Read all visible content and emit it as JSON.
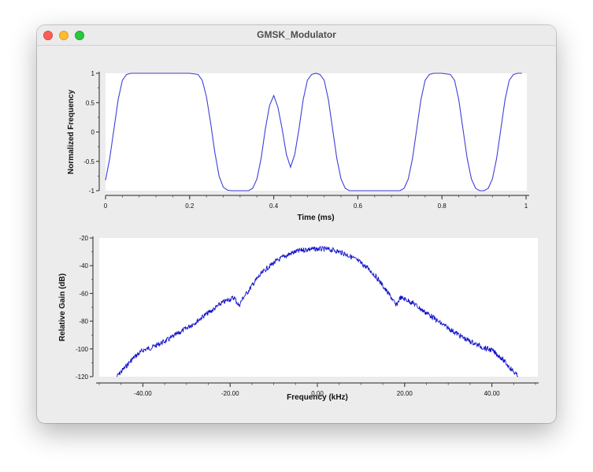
{
  "window": {
    "title": "GMSK_Modulator"
  },
  "chart_data": [
    {
      "type": "line",
      "xlabel": "Time (ms)",
      "ylabel": "Normalized Frequency",
      "xlim": [
        0,
        1
      ],
      "ylim": [
        -1,
        1
      ],
      "xticks": [
        "0",
        "0.2",
        "0.4",
        "0.6",
        "0.8",
        "1"
      ],
      "yticks": [
        "1",
        "0.5",
        "0",
        "-0.5",
        "-1"
      ],
      "line_color": "#3f3fd8",
      "series": [
        {
          "x": [
            0,
            0.01,
            0.02,
            0.03,
            0.04,
            0.05,
            0.06,
            0.08,
            0.1,
            0.2,
            0.22,
            0.23,
            0.24,
            0.25,
            0.26,
            0.27,
            0.28,
            0.29,
            0.3,
            0.31,
            0.32,
            0.34,
            0.35,
            0.36,
            0.37,
            0.38,
            0.39,
            0.4,
            0.41,
            0.42,
            0.43,
            0.44,
            0.45,
            0.46,
            0.47,
            0.48,
            0.49,
            0.5,
            0.51,
            0.52,
            0.53,
            0.54,
            0.55,
            0.56,
            0.57,
            0.58,
            0.6,
            0.7,
            0.71,
            0.72,
            0.73,
            0.74,
            0.75,
            0.76,
            0.77,
            0.78,
            0.79,
            0.8,
            0.82,
            0.83,
            0.84,
            0.85,
            0.86,
            0.87,
            0.88,
            0.89,
            0.9,
            0.91,
            0.92,
            0.93,
            0.94,
            0.95,
            0.96,
            0.97,
            0.98,
            0.99
          ],
          "y": [
            -0.82,
            -0.45,
            0.05,
            0.55,
            0.88,
            0.98,
            1,
            1,
            1,
            1,
            0.98,
            0.88,
            0.6,
            0.15,
            -0.35,
            -0.75,
            -0.94,
            -0.99,
            -1,
            -1,
            -1,
            -1,
            -0.96,
            -0.8,
            -0.45,
            0.05,
            0.45,
            0.62,
            0.42,
            0.05,
            -0.38,
            -0.6,
            -0.38,
            0.05,
            0.55,
            0.88,
            0.98,
            1,
            0.98,
            0.88,
            0.55,
            0.05,
            -0.45,
            -0.8,
            -0.96,
            -1,
            -1,
            -1,
            -0.96,
            -0.8,
            -0.45,
            0.05,
            0.55,
            0.88,
            0.98,
            1,
            1,
            1,
            0.98,
            0.88,
            0.55,
            0.05,
            -0.45,
            -0.8,
            -0.96,
            -1,
            -1,
            -0.96,
            -0.8,
            -0.45,
            0.05,
            0.55,
            0.88,
            0.98,
            1,
            1
          ]
        }
      ]
    },
    {
      "type": "line",
      "xlabel": "Frequency (kHz)",
      "ylabel": "Relative Gain (dB)",
      "xlim": [
        -50,
        50
      ],
      "ylim": [
        -120,
        -20
      ],
      "xticks": [
        "-40.00",
        "-20.00",
        "0.00",
        "20.00",
        "40.00"
      ],
      "yticks": [
        "-20",
        "-40",
        "-60",
        "-80",
        "-100",
        "-120"
      ],
      "line_color": "#1010c8",
      "series": [
        {
          "x": [
            -46,
            -44,
            -42,
            -40,
            -38,
            -36,
            -34,
            -32,
            -30,
            -28,
            -26,
            -24,
            -22,
            -20,
            -19,
            -18,
            -17,
            -16,
            -14,
            -12,
            -10,
            -8,
            -6,
            -4,
            -2,
            0,
            2,
            4,
            6,
            8,
            10,
            12,
            14,
            16,
            17,
            18,
            19,
            20,
            22,
            24,
            26,
            28,
            30,
            32,
            34,
            36,
            38,
            40,
            42,
            44,
            46
          ],
          "y": [
            -120,
            -113,
            -106,
            -101,
            -99,
            -96,
            -93,
            -89,
            -85,
            -81,
            -76,
            -72,
            -67,
            -64,
            -63,
            -69,
            -63,
            -59,
            -50,
            -43,
            -38,
            -34,
            -31,
            -29,
            -28,
            -28,
            -28,
            -29,
            -31,
            -34,
            -38,
            -43,
            -50,
            -59,
            -63,
            -69,
            -63,
            -64,
            -67,
            -72,
            -76,
            -81,
            -85,
            -89,
            -93,
            -96,
            -99,
            -101,
            -106,
            -113,
            -120
          ]
        }
      ]
    }
  ]
}
